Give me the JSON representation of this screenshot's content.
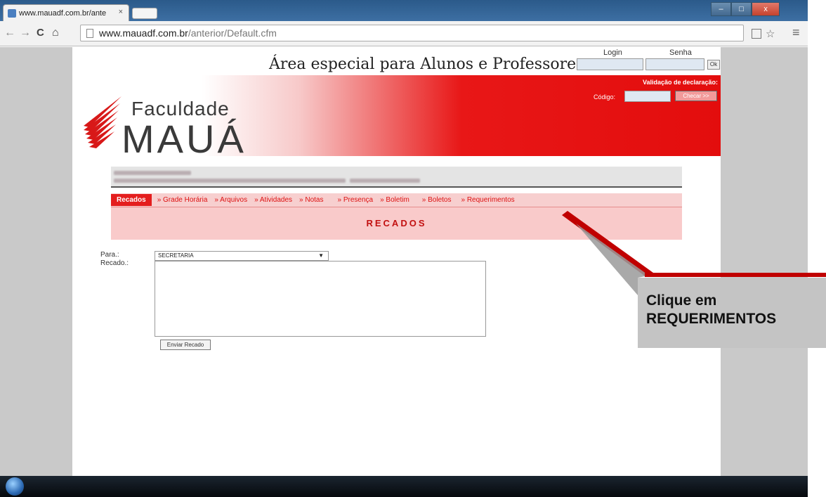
{
  "browser": {
    "tab_title": "www.mauadf.com.br/ante",
    "tab_close": "×",
    "url_domain": "www.mauadf.com.br",
    "url_path": "/anterior/Default.cfm",
    "back": "←",
    "forward": "→",
    "reload": "C",
    "home": "⌂",
    "menu": "≡",
    "star": "☆",
    "window_min": "–",
    "window_max": "□",
    "window_close": "x"
  },
  "header": {
    "heading": "Área especial para Alunos e Professores",
    "login_label": "Login",
    "senha_label": "Senha",
    "ok_label": "Ok",
    "validacao_label": "Validação de declaração:",
    "codigo_label": "Código:",
    "checar_label": "Checar >>"
  },
  "logo": {
    "line1": "Faculdade",
    "line2": "MAUÁ"
  },
  "nav": {
    "items": [
      "Recados",
      "» Grade Horária",
      "» Arquivos",
      "» Atividades",
      "» Notas",
      "» Presença",
      "» Boletim",
      "» Boletos",
      "» Requerimentos"
    ]
  },
  "section_title": "RECADOS",
  "form": {
    "para_label": "Para.:",
    "para_value": "SECRETARIA",
    "recado_label": "Recado.:",
    "submit_label": "Enviar Recado"
  },
  "callout": {
    "line1": "Clique em",
    "line2": "REQUERIMENTOS"
  },
  "colors": {
    "accent_red": "#e30d0d",
    "nav_bg": "#f7cfcf",
    "callout_bg": "#c4c4c4"
  }
}
